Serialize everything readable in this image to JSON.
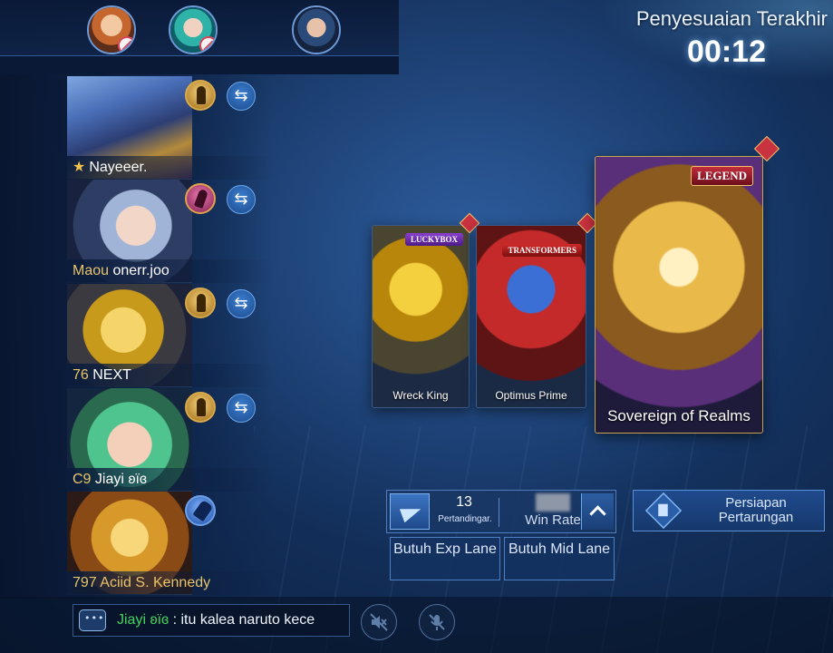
{
  "header": {
    "timer_label": "Penyesuaian Terakhir",
    "timer_value": "00:12"
  },
  "enemy_bans": [
    {
      "hero": "enemy-hero-1",
      "banned": true
    },
    {
      "hero": "enemy-hero-2",
      "banned": true
    },
    {
      "hero": "enemy-hero-3",
      "banned": false
    }
  ],
  "team": [
    {
      "prefix": "",
      "name": "Nayeeer.",
      "starred": true,
      "role_icon": "fighter-icon",
      "swap": true
    },
    {
      "prefix": "Maou",
      "name": "onerr.joo",
      "starred": false,
      "role_icon": "mage-icon",
      "swap": true
    },
    {
      "prefix": "76",
      "name": "NEXT",
      "starred": false,
      "role_icon": "fighter-icon",
      "swap": true
    },
    {
      "prefix": "C9",
      "name": "Jiayi ʚïɞ",
      "starred": false,
      "role_icon": "fighter-icon",
      "swap": true
    },
    {
      "prefix": "797",
      "name": "Aciid S. Kennedy",
      "starred": false,
      "role_icon": "assassin-icon",
      "swap": false
    }
  ],
  "skins": [
    {
      "name": "Wreck King",
      "badge": "LUCKYBOX"
    },
    {
      "name": "Optimus Prime",
      "badge": "TRANSFORMERS"
    },
    {
      "name": "Sovereign of Realms",
      "badge": "LEGEND"
    }
  ],
  "stats": {
    "matches_value": "13",
    "matches_label": "Pertandingar.",
    "winrate_label": "Win Rate"
  },
  "lanes": {
    "exp": "Butuh Exp Lane",
    "mid": "Butuh Mid Lane"
  },
  "prep_button": {
    "label": "Persiapan Pertarungan"
  },
  "chat": {
    "speaker": "Jiayi ʚïɞ",
    "message": ": itu kalea naruto kece"
  },
  "icons": {
    "mute_sound": "speaker-muted-icon",
    "mute_mic": "mic-muted-icon",
    "swap": "swap-icon"
  },
  "colors": {
    "accent_gold": "#e9c46a",
    "chat_speaker": "#42d35d",
    "ban_red": "#d9475c"
  }
}
